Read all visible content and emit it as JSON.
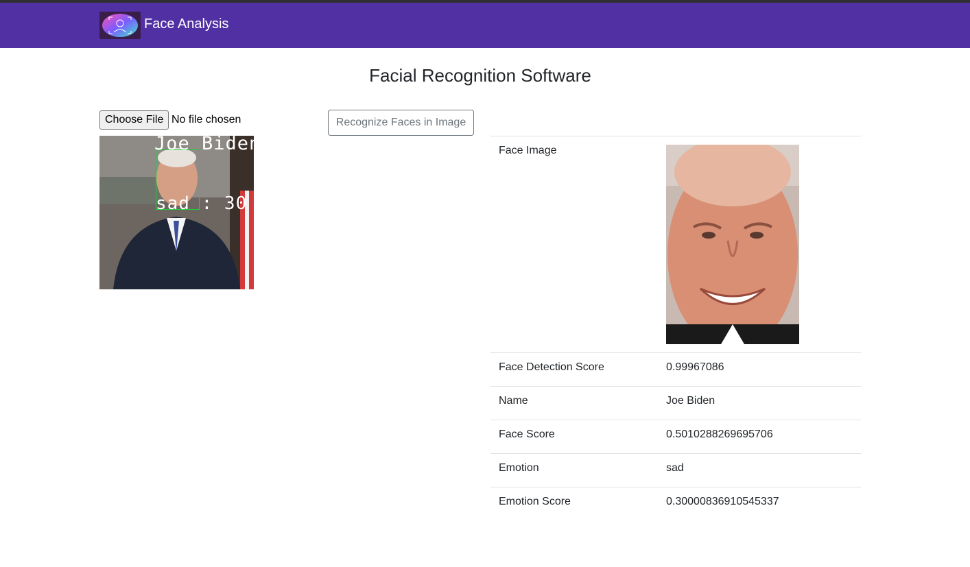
{
  "navbar": {
    "brand": "Face Analysis",
    "logo_icon": "face-scan-logo"
  },
  "page": {
    "title": "Facial Recognition Software"
  },
  "upload": {
    "choose_label": "Choose File",
    "status": "No file chosen"
  },
  "actions": {
    "recognize_label": "Recognize Faces in Image"
  },
  "preview": {
    "overlay_name": "Joe Biden",
    "overlay_emotion": "sad : 30"
  },
  "results": {
    "face_image_label": "Face Image",
    "rows": [
      {
        "label": "Face Detection Score",
        "value": "0.99967086"
      },
      {
        "label": "Name",
        "value": "Joe Biden"
      },
      {
        "label": "Face Score",
        "value": "0.5010288269695706"
      },
      {
        "label": "Emotion",
        "value": "sad"
      },
      {
        "label": "Emotion Score",
        "value": "0.30000836910545337"
      }
    ]
  },
  "colors": {
    "navbar": "#5030a3",
    "face_box": "#1fd13a"
  }
}
